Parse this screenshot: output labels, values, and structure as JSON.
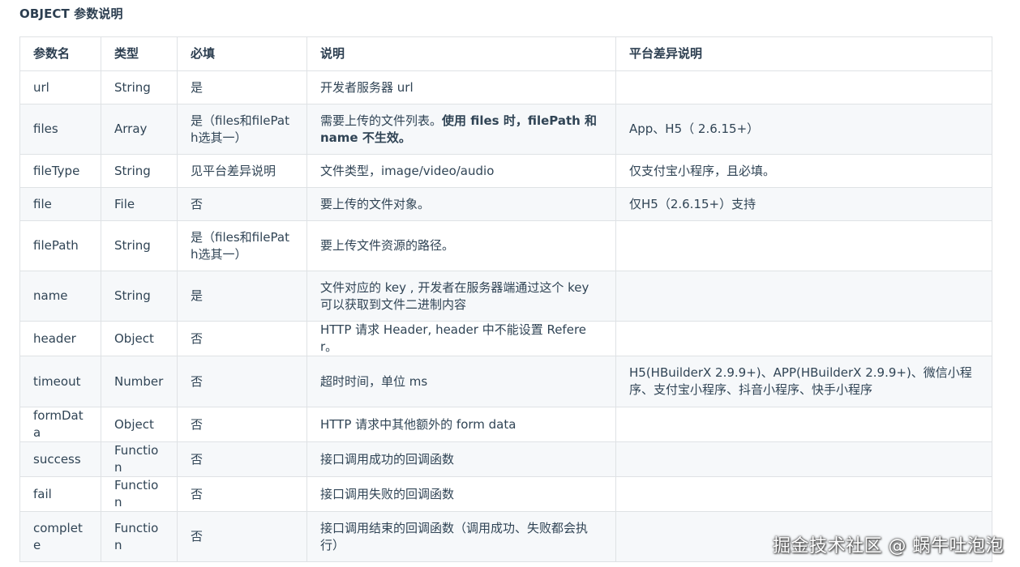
{
  "heading": "OBJECT 参数说明",
  "columns": [
    "参数名",
    "类型",
    "必填",
    "说明",
    "平台差异说明"
  ],
  "rows": [
    {
      "name": "url",
      "type": "String",
      "required": "是",
      "desc": "开发者服务器 url",
      "platform": ""
    },
    {
      "name": "files",
      "type": "Array",
      "required": "是（files和filePath选其一）",
      "desc": "需要上传的文件列表。",
      "desc_bold": "使用 files 时，filePath 和 name 不生效。",
      "platform": "App、H5（ 2.6.15+）"
    },
    {
      "name": "fileType",
      "type": "String",
      "required": "见平台差异说明",
      "desc": "文件类型，image/video/audio",
      "platform": "仅支付宝小程序，且必填。"
    },
    {
      "name": "file",
      "type": "File",
      "required": "否",
      "desc": "要上传的文件对象。",
      "platform": "仅H5（2.6.15+）支持"
    },
    {
      "name": "filePath",
      "type": "String",
      "required": "是（files和filePath选其一）",
      "desc": "要上传文件资源的路径。",
      "platform": ""
    },
    {
      "name": "name",
      "type": "String",
      "required": "是",
      "desc": "文件对应的 key , 开发者在服务器端通过这个 key 可以获取到文件二进制内容",
      "platform": ""
    },
    {
      "name": "header",
      "type": "Object",
      "required": "否",
      "desc": "HTTP 请求 Header, header 中不能设置 Referer。",
      "platform": ""
    },
    {
      "name": "timeout",
      "type": "Number",
      "required": "否",
      "desc": "超时时间，单位 ms",
      "platform": "H5(HBuilderX 2.9.9+)、APP(HBuilderX 2.9.9+)、微信小程序、支付宝小程序、抖音小程序、快手小程序"
    },
    {
      "name": "formData",
      "type": "Object",
      "required": "否",
      "desc": "HTTP 请求中其他额外的 form data",
      "platform": ""
    },
    {
      "name": "success",
      "type": "Function",
      "required": "否",
      "desc": "接口调用成功的回调函数",
      "platform": ""
    },
    {
      "name": "fail",
      "type": "Function",
      "required": "否",
      "desc": "接口调用失败的回调函数",
      "platform": ""
    },
    {
      "name": "complete",
      "type": "Function",
      "required": "否",
      "desc": "接口调用结束的回调函数（调用成功、失败都会执行）",
      "platform": ""
    }
  ],
  "watermark": "掘金技术社区 @ 蜗牛吐泡泡"
}
